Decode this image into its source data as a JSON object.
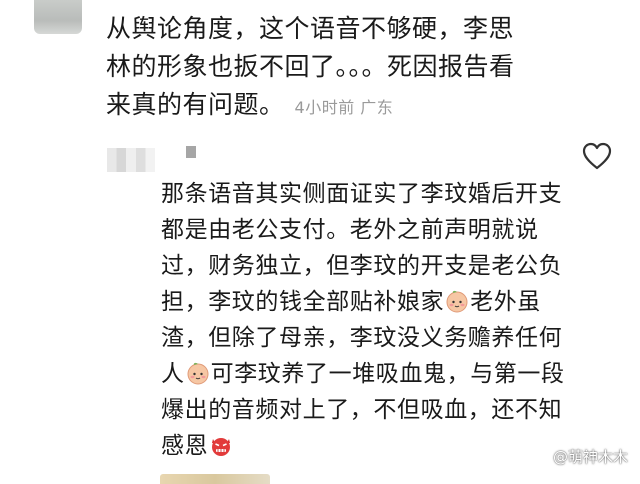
{
  "comment": {
    "text": "从舆论角度，这个语音不够硬，李思林的形象也扳不回了。。。死因报告看来真的有问题。",
    "time": "4小时前",
    "location": "广东"
  },
  "reply": {
    "text_parts": [
      "那条语音其实侧面证实了李玟婚后开支都是由老公支付。老外之前声明就说过，财务独立，但李玟的开支是老公负担，李玟的钱全部贴补娘家",
      "老外虽渣，但除了母亲，李玟没义务赡养任何人",
      "可李玟养了一堆吸血鬼，与第一段爆出的音频对上了，不但吸血，还不知感恩"
    ],
    "emoji_after_1": "peach-face-emoji",
    "emoji_after_2": "peach-face-emoji",
    "emoji_after_3": "angry-devil-emoji"
  },
  "like_icon": "heart-outline-icon",
  "watermark": "@萌神木木",
  "colors": {
    "meta": "#9a9a9a",
    "text": "#1a1a1a"
  }
}
